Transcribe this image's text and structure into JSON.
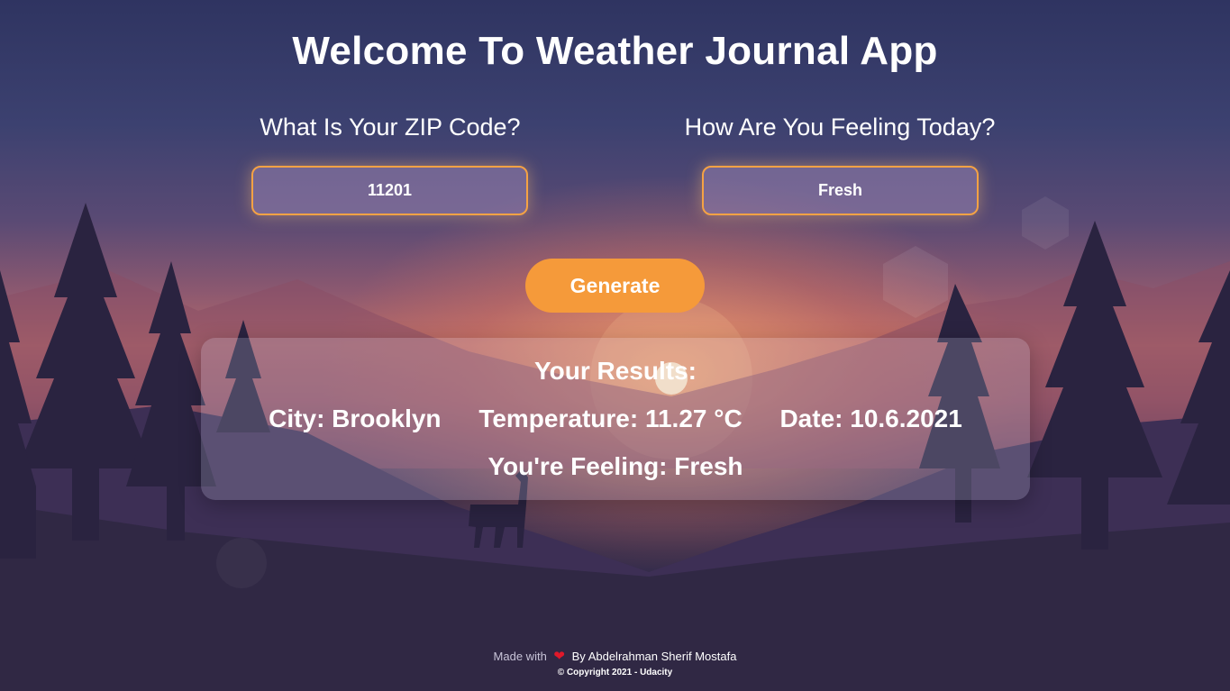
{
  "header": {
    "title": "Welcome To Weather Journal App"
  },
  "form": {
    "zip_label": "What Is Your ZIP Code?",
    "zip_value": "11201",
    "feeling_label": "How Are You Feeling Today?",
    "feeling_value": "Fresh",
    "generate_label": "Generate"
  },
  "results": {
    "title": "Your Results:",
    "city": "City: Brooklyn",
    "temperature": "Temperature: 11.27 °C",
    "date": "Date: 10.6.2021",
    "feeling": "You're Feeling: Fresh"
  },
  "footer": {
    "made_with": "Made with",
    "heart_icon": "heart-icon",
    "by_author": "By Abdelrahman Sherif Mostafa",
    "copyright": "© Copyright 2021 - Udacity"
  },
  "colors": {
    "accent": "#f59a3a",
    "field_border": "#f5a244",
    "heart": "#e0182a"
  }
}
